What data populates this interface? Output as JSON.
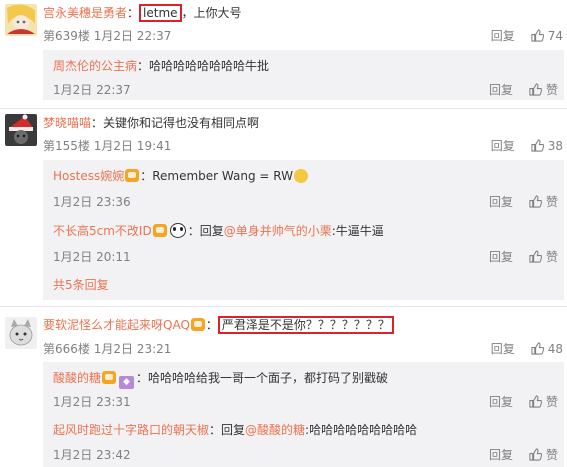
{
  "comments": [
    {
      "username": "宫永美穗是勇者",
      "colon": "：",
      "highlight": "letme",
      "text_after": "，上你大号",
      "meta": "第639楼  1月2日 22:37",
      "reply": "回复",
      "likes": "74",
      "avatar_icon": "anime-avatar-blonde",
      "subreplies": [
        {
          "username": "周杰伦的公主病",
          "text": "：哈哈哈哈哈哈哈哈牛批",
          "time": "1月2日 22:37",
          "reply": "回复",
          "like": "赞"
        }
      ]
    },
    {
      "username": "梦晓喵喵",
      "text": "：关键你和记得也没有相同点啊",
      "meta": "第155楼  1月2日 19:41",
      "reply": "回复",
      "likes": "38",
      "avatar_icon": "christmas-hat-avatar",
      "subreplies": [
        {
          "username": "Hostess婉婉",
          "text": "：Remember Wang = RW",
          "time": "1月2日 23:36",
          "reply": "回复",
          "like": "赞"
        },
        {
          "username": "不长高5cm不改ID",
          "text_pre": "：回复",
          "mention": "@单身并帅气的小栗",
          "text_post": ":牛逼牛逼",
          "time": "1月2日 20:11",
          "reply": "回复",
          "like": "赞"
        }
      ],
      "more": "共5条回复"
    },
    {
      "username": "要软泥怪么才能起来呀QAQ",
      "colon": "：",
      "highlight": "严君泽是不是你？？？？？？？",
      "meta": "第666楼  1月2日 23:21",
      "reply": "回复",
      "likes": "48",
      "avatar_icon": "cat-avatar",
      "subreplies": [
        {
          "username": "酸酸的糖",
          "text": "：哈哈哈哈给我一哥一个面子，都打码了别戳破",
          "time": "1月2日 23:31",
          "reply": "回复",
          "like": "赞"
        },
        {
          "username": "起风时跑过十字路口的朝天椒",
          "text_pre": "：回复",
          "mention": "@酸酸的糖",
          "text_post": ":哈哈哈哈哈哈哈哈哈",
          "time": "1月2日 23:42",
          "reply": "回复",
          "like": "赞"
        }
      ]
    }
  ],
  "colors": {
    "username": "#eb7350",
    "highlight_border": "#d8232a",
    "meta": "#808080",
    "subbox": "#f2f2f5"
  }
}
